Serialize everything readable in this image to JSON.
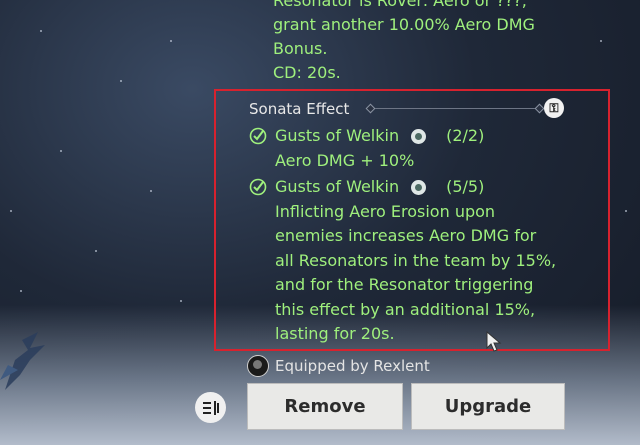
{
  "top_effect": {
    "lines": [
      "Resonator is Rover: Aero or ???,",
      "grant another 10.00% Aero DMG",
      "Bonus.",
      "CD: 20s."
    ]
  },
  "sonata": {
    "title": "Sonata Effect",
    "effects": [
      {
        "name": "Gusts of Welkin",
        "count": "(2/2)",
        "description": [
          "Aero DMG + 10%"
        ]
      },
      {
        "name": "Gusts of Welkin",
        "count": "(5/5)",
        "description": [
          "Inflicting Aero Erosion upon",
          "enemies increases Aero DMG for",
          "all Resonators in the team by 15%,",
          "and for the Resonator triggering",
          "this effect by an additional 15%,",
          "lasting for 20s."
        ]
      }
    ]
  },
  "equipped": {
    "label": "Equipped by Rexlent"
  },
  "buttons": {
    "remove": "Remove",
    "upgrade": "Upgrade"
  },
  "colors": {
    "effect_text": "#9ff07d",
    "highlight_border": "#d7222e",
    "button_bg": "#e9e9e7"
  }
}
